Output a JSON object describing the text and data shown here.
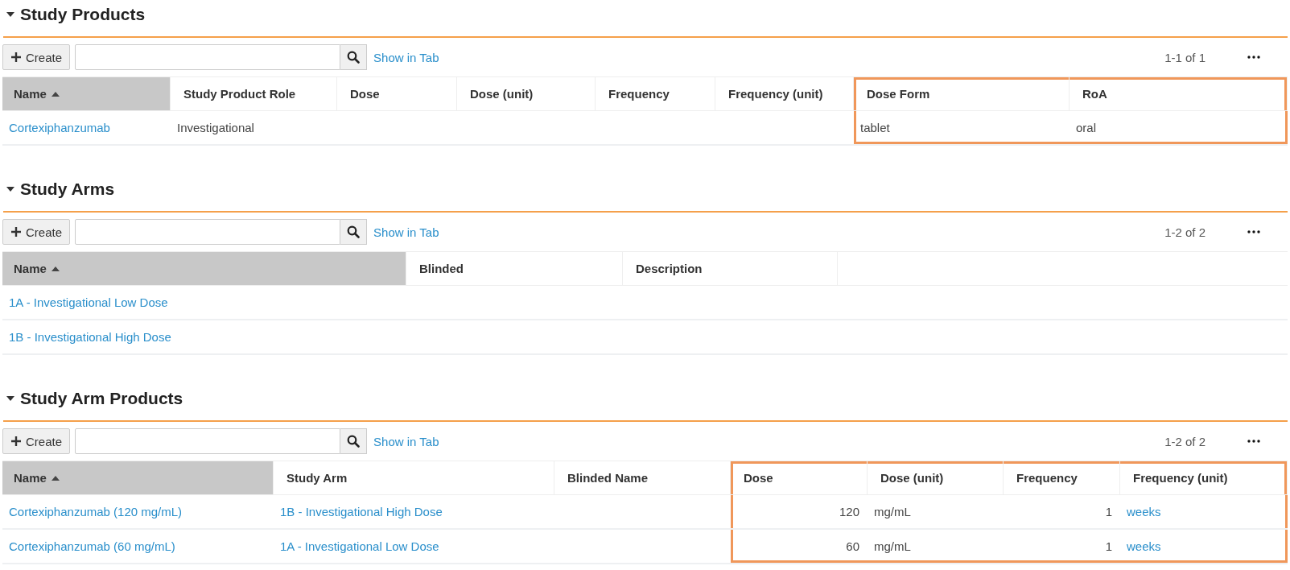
{
  "sections": [
    {
      "title": "Study Products",
      "expanded": true,
      "create_label": "Create",
      "show_in_tab": "Show in Tab",
      "pagination": "1-1 of 1",
      "columns": [
        {
          "label": "Name",
          "sorted": true,
          "highlighted": false
        },
        {
          "label": "Study Product Role",
          "sorted": false,
          "highlighted": false
        },
        {
          "label": "Dose",
          "sorted": false,
          "highlighted": false
        },
        {
          "label": "Dose (unit)",
          "sorted": false,
          "highlighted": false
        },
        {
          "label": "Frequency",
          "sorted": false,
          "highlighted": false
        },
        {
          "label": "Frequency (unit)",
          "sorted": false,
          "highlighted": false
        },
        {
          "label": "Dose Form",
          "sorted": false,
          "highlighted": true
        },
        {
          "label": "RoA",
          "sorted": false,
          "highlighted": true
        }
      ],
      "rows": [
        [
          {
            "kind": "link",
            "text": "Cortexiphanzumab"
          },
          {
            "kind": "text",
            "text": "Investigational"
          },
          {
            "kind": "text",
            "text": ""
          },
          {
            "kind": "text",
            "text": ""
          },
          {
            "kind": "text",
            "text": ""
          },
          {
            "kind": "text",
            "text": ""
          },
          {
            "kind": "text",
            "text": "tablet"
          },
          {
            "kind": "text",
            "text": "oral"
          }
        ]
      ]
    },
    {
      "title": "Study Arms",
      "expanded": true,
      "create_label": "Create",
      "show_in_tab": "Show in Tab",
      "pagination": "1-2 of 2",
      "columns": [
        {
          "label": "Name",
          "sorted": true,
          "highlighted": false
        },
        {
          "label": "Blinded",
          "sorted": false,
          "highlighted": false
        },
        {
          "label": "Description",
          "sorted": false,
          "highlighted": false
        }
      ],
      "rows": [
        [
          {
            "kind": "link",
            "text": "1A - Investigational Low Dose"
          },
          {
            "kind": "text",
            "text": ""
          },
          {
            "kind": "text",
            "text": ""
          }
        ],
        [
          {
            "kind": "link",
            "text": "1B - Investigational High Dose"
          },
          {
            "kind": "text",
            "text": ""
          },
          {
            "kind": "text",
            "text": ""
          }
        ]
      ]
    },
    {
      "title": "Study Arm Products",
      "expanded": true,
      "create_label": "Create",
      "show_in_tab": "Show in Tab",
      "pagination": "1-2 of 2",
      "columns": [
        {
          "label": "Name",
          "sorted": true,
          "highlighted": false
        },
        {
          "label": "Study Arm",
          "sorted": false,
          "highlighted": false
        },
        {
          "label": "Blinded Name",
          "sorted": false,
          "highlighted": false
        },
        {
          "label": "Dose",
          "sorted": false,
          "highlighted": true
        },
        {
          "label": "Dose (unit)",
          "sorted": false,
          "highlighted": true
        },
        {
          "label": "Frequency",
          "sorted": false,
          "highlighted": true
        },
        {
          "label": "Frequency (unit)",
          "sorted": false,
          "highlighted": true
        }
      ],
      "rows": [
        [
          {
            "kind": "link",
            "text": "Cortexiphanzumab (120 mg/mL)"
          },
          {
            "kind": "link",
            "text": "1B - Investigational High Dose"
          },
          {
            "kind": "text",
            "text": ""
          },
          {
            "kind": "number",
            "text": "120"
          },
          {
            "kind": "text",
            "text": "mg/mL"
          },
          {
            "kind": "number",
            "text": "1"
          },
          {
            "kind": "link",
            "text": "weeks"
          }
        ],
        [
          {
            "kind": "link",
            "text": "Cortexiphanzumab (60 mg/mL)"
          },
          {
            "kind": "link",
            "text": "1A - Investigational Low Dose"
          },
          {
            "kind": "text",
            "text": ""
          },
          {
            "kind": "number",
            "text": "60"
          },
          {
            "kind": "text",
            "text": "mg/mL"
          },
          {
            "kind": "number",
            "text": "1"
          },
          {
            "kind": "link",
            "text": "weeks"
          }
        ]
      ]
    }
  ]
}
